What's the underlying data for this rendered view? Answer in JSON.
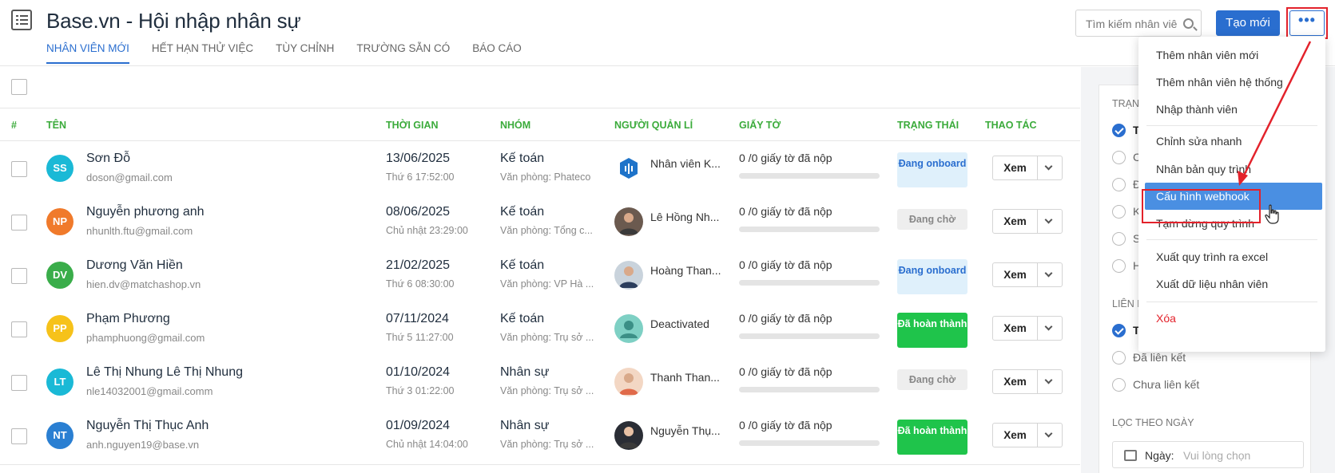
{
  "header": {
    "title": "Base.vn - Hội nhập nhân sự",
    "tabs": [
      {
        "label": "NHÂN VIÊN MỚI",
        "active": true
      },
      {
        "label": "HẾT HẠN THỬ VIỆC"
      },
      {
        "label": "TÙY CHỈNH"
      },
      {
        "label": "TRƯỜNG SẴN CÓ"
      },
      {
        "label": "BÁO CÁO"
      }
    ],
    "search_placeholder": "Tìm kiếm nhân viê",
    "new_button": "Tạo mới",
    "more_button": "•••"
  },
  "table": {
    "columns": {
      "index": "#",
      "name": "TÊN",
      "time": "THỜI GIAN",
      "group": "NHÓM",
      "manager": "NGƯỜI QUẢN LÍ",
      "docs": "GIẤY TỜ",
      "status": "TRẠNG THÁI",
      "action": "THAO TÁC"
    },
    "rows": [
      {
        "initials": "SS",
        "avatar_color": "#1ab9d6",
        "name": "Sơn Đỗ",
        "email": "doson@gmail.com",
        "date": "13/06/2025",
        "time": "Thứ 6 17:52:00",
        "group": "Kế toán",
        "office": "Văn phòng: Phateco",
        "manager": "Nhân viên K...",
        "docs": "0 /0 giấy tờ đã nộp",
        "status": "Đang onboard",
        "status_type": "onb",
        "action": "Xem"
      },
      {
        "initials": "NP",
        "avatar_color": "#f07a2b",
        "name": "Nguyễn phương anh",
        "email": "nhunlth.ftu@gmail.com",
        "date": "08/06/2025",
        "time": "Chủ nhật 23:29:00",
        "group": "Kế toán",
        "office": "Văn phòng: Tổng c...",
        "manager": "Lê Hồng Nh...",
        "docs": "0 /0 giấy tờ đã nộp",
        "status": "Đang chờ",
        "status_type": "wait",
        "action": "Xem"
      },
      {
        "initials": "DV",
        "avatar_color": "#3aad4a",
        "name": "Dương Văn Hiền",
        "email": "hien.dv@matchashop.vn",
        "date": "21/02/2025",
        "time": "Thứ 6 08:30:00",
        "group": "Kế toán",
        "office": "Văn phòng: VP Hà ...",
        "manager": "Hoàng Than...",
        "docs": "0 /0 giấy tờ đã nộp",
        "status": "Đang onboard",
        "status_type": "onb",
        "action": "Xem"
      },
      {
        "initials": "PP",
        "avatar_color": "#f6c21a",
        "name": "Phạm Phương",
        "email": "phamphuong@gmail.com",
        "date": "07/11/2024",
        "time": "Thứ 5 11:27:00",
        "group": "Kế toán",
        "office": "Văn phòng: Trụ sở ...",
        "manager": "Deactivated",
        "docs": "0 /0 giấy tờ đã nộp",
        "status": "Đã hoàn thành",
        "status_type": "done",
        "action": "Xem"
      },
      {
        "initials": "LT",
        "avatar_color": "#1ab9d6",
        "name": "Lê Thị Nhung Lê Thị Nhung",
        "email": "nle14032001@gmail.comm",
        "date": "01/10/2024",
        "time": "Thứ 3 01:22:00",
        "group": "Nhân sự",
        "office": "Văn phòng: Trụ sở ...",
        "manager": "Thanh Than...",
        "docs": "0 /0 giấy tờ đã nộp",
        "status": "Đang chờ",
        "status_type": "wait",
        "action": "Xem"
      },
      {
        "initials": "NT",
        "avatar_color": "#2a7fd2",
        "name": "Nguyễn Thị Thục Anh",
        "email": "anh.nguyen19@base.vn",
        "date": "01/09/2024",
        "time": "Chủ nhật 14:04:00",
        "group": "Nhân sự",
        "office": "Văn phòng: Trụ sở ...",
        "manager": "Nguyễn Thụ...",
        "docs": "0 /0 giấy tờ đã nộp",
        "status": "Đã hoàn thành",
        "status_type": "done",
        "action": "Xem"
      }
    ]
  },
  "filters": {
    "status_title": "TRẠNG",
    "status_options": [
      "T",
      "C",
      "Đ",
      "K",
      "S",
      "H"
    ],
    "link_title": "LIÊN K",
    "link_options": [
      "T",
      "Đã liên kết",
      "Chưa liên kết"
    ],
    "date_title": "LỌC THEO NGÀY",
    "date_label": "Ngày:",
    "date_placeholder": "Vui lòng chọn"
  },
  "dropdown": {
    "items": [
      "Thêm nhân viên mới",
      "Thêm nhân viên hệ thống",
      "Nhập thành viên",
      "Chỉnh sửa nhanh",
      "Nhân bản quy trình",
      "Cấu hình webhook",
      "Tạm dừng quy trình",
      "Xuất quy trình ra excel",
      "Xuất dữ liệu nhân viên",
      "Xóa"
    ],
    "highlighted": "Cấu hình webhook"
  },
  "colors": {
    "primary": "#2a6ecf",
    "header_green": "#3bab3b",
    "done_green": "#1fc44b",
    "annotation_red": "#e3222b"
  }
}
